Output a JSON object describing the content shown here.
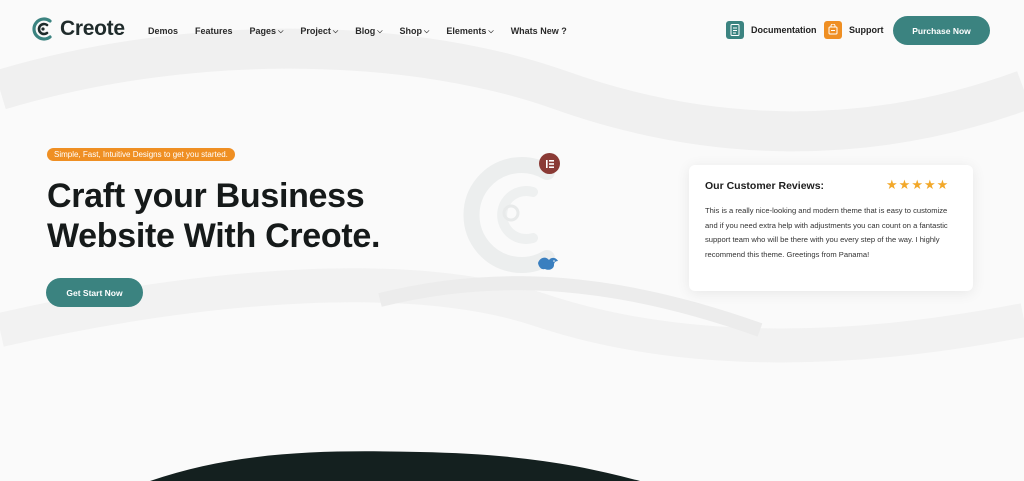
{
  "brand": {
    "name": "Creote"
  },
  "nav": {
    "items": [
      {
        "label": "Demos",
        "dropdown": false
      },
      {
        "label": "Features",
        "dropdown": false
      },
      {
        "label": "Pages",
        "dropdown": true
      },
      {
        "label": "Project",
        "dropdown": true
      },
      {
        "label": "Blog",
        "dropdown": true
      },
      {
        "label": "Shop",
        "dropdown": true
      },
      {
        "label": "Elements",
        "dropdown": true
      },
      {
        "label": "Whats New ?",
        "dropdown": false
      }
    ],
    "documentation_label": "Documentation",
    "support_label": "Support",
    "purchase_label": "Purchase Now"
  },
  "hero": {
    "tagline": "Simple, Fast, Intuitive Designs to get you started.",
    "headline_line1": "Craft your Business",
    "headline_line2": "Website With Creote.",
    "cta_label": "Get Start Now"
  },
  "review": {
    "title": "Our Customer Reviews:",
    "rating": 5,
    "max_rating": 5,
    "text": "This is a really nice-looking and modern theme that is easy to customize and if you need extra help with adjustments you can count on a fantastic support team who will be there with you every step of the way. I highly recommend this theme. Greetings from Panama!"
  },
  "colors": {
    "primary": "#3b8380",
    "accent_orange": "#ef8f23",
    "star": "#f2a82a",
    "elementor": "#8a3a35",
    "dark": "#14201f"
  },
  "icons": {
    "documentation": "document-icon",
    "support": "support-icon",
    "elementor": "elementor-icon",
    "bird": "bird-icon"
  }
}
